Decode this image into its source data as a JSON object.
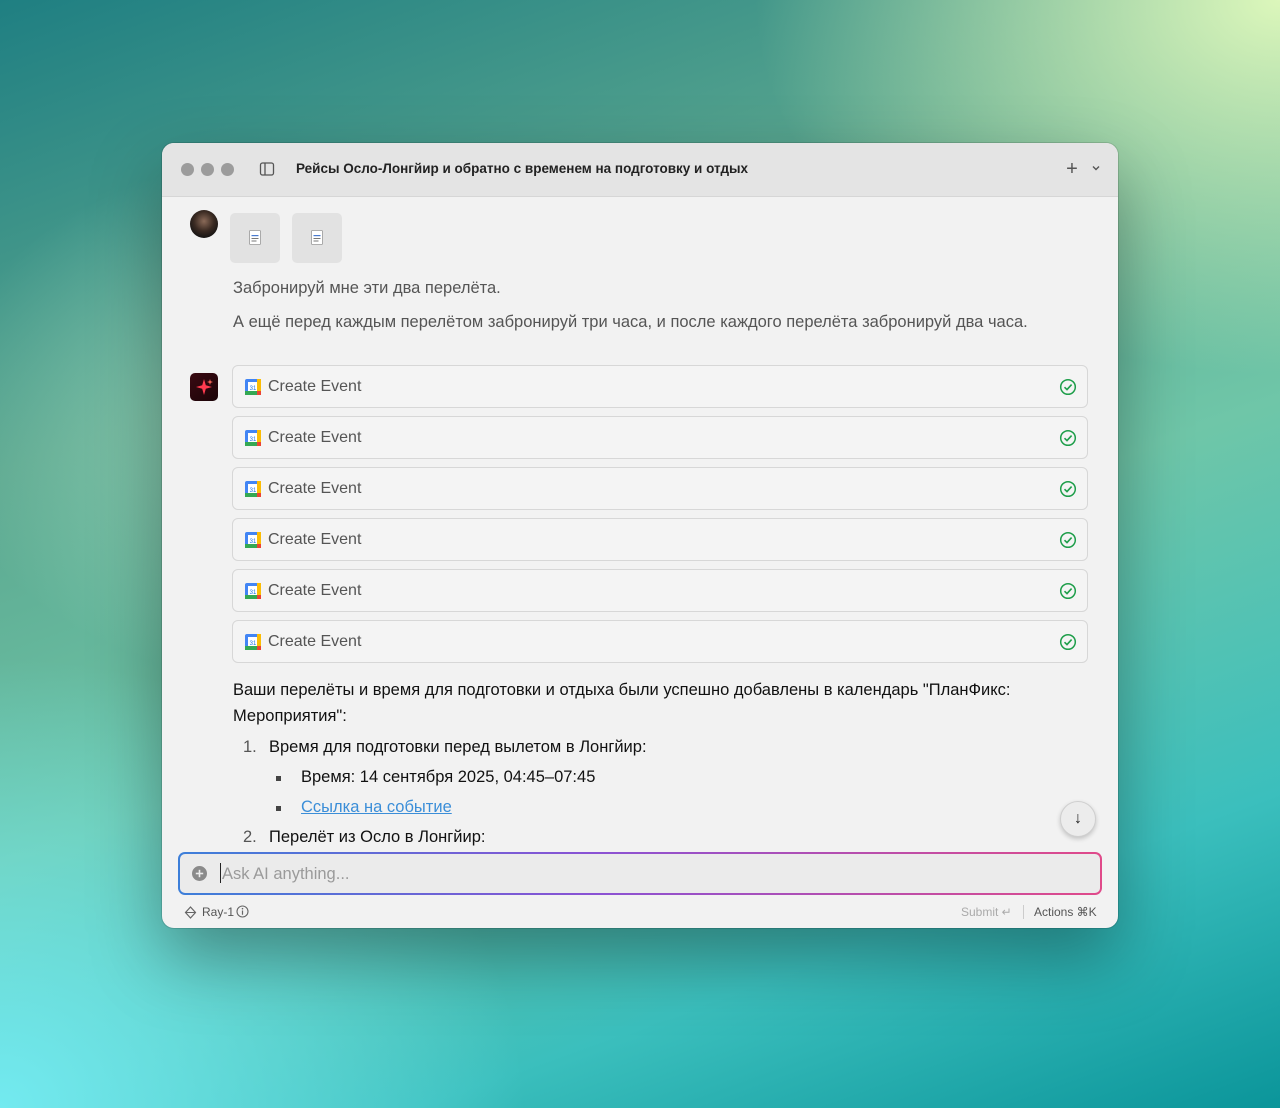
{
  "window": {
    "title": "Рейсы Осло-Лонгйир и обратно с временем на подготовку и отдых"
  },
  "user_message": {
    "attachments": [
      "file-icon",
      "file-icon"
    ],
    "lines": [
      "Забронируй мне эти два перелёта.",
      "А ещё перед каждым перелётом забронируй три часа, и после каждого перелёта забронируй два часа."
    ]
  },
  "tool_calls": [
    {
      "label": "Create Event",
      "icon": "google-calendar-icon",
      "status": "success"
    },
    {
      "label": "Create Event",
      "icon": "google-calendar-icon",
      "status": "success"
    },
    {
      "label": "Create Event",
      "icon": "google-calendar-icon",
      "status": "success"
    },
    {
      "label": "Create Event",
      "icon": "google-calendar-icon",
      "status": "success"
    },
    {
      "label": "Create Event",
      "icon": "google-calendar-icon",
      "status": "success"
    },
    {
      "label": "Create Event",
      "icon": "google-calendar-icon",
      "status": "success"
    }
  ],
  "ai_response": {
    "intro": "Ваши перелёты и время для подготовки и отдыха были успешно добавлены в календарь \"ПланФикс: Мероприятия\":",
    "items": [
      {
        "number": "1.",
        "title": "Время для подготовки перед вылетом в Лонгйир:",
        "bullets": [
          "Время: 14 сентября 2025, 04:45–07:45"
        ],
        "link": "Ссылка на событие"
      },
      {
        "number": "2.",
        "title": "Перелёт из Осло в Лонгйир:"
      }
    ]
  },
  "composer": {
    "placeholder": "Ask AI anything...",
    "value": ""
  },
  "footer": {
    "model": "Ray-1",
    "submit_label": "Submit ↵",
    "actions_label": "Actions ⌘K"
  },
  "colors": {
    "accent_gradient": [
      "#3d7fd9",
      "#8a52d4",
      "#e04a8a"
    ],
    "success": "#1e9e4a",
    "link": "#3b8ed8"
  }
}
